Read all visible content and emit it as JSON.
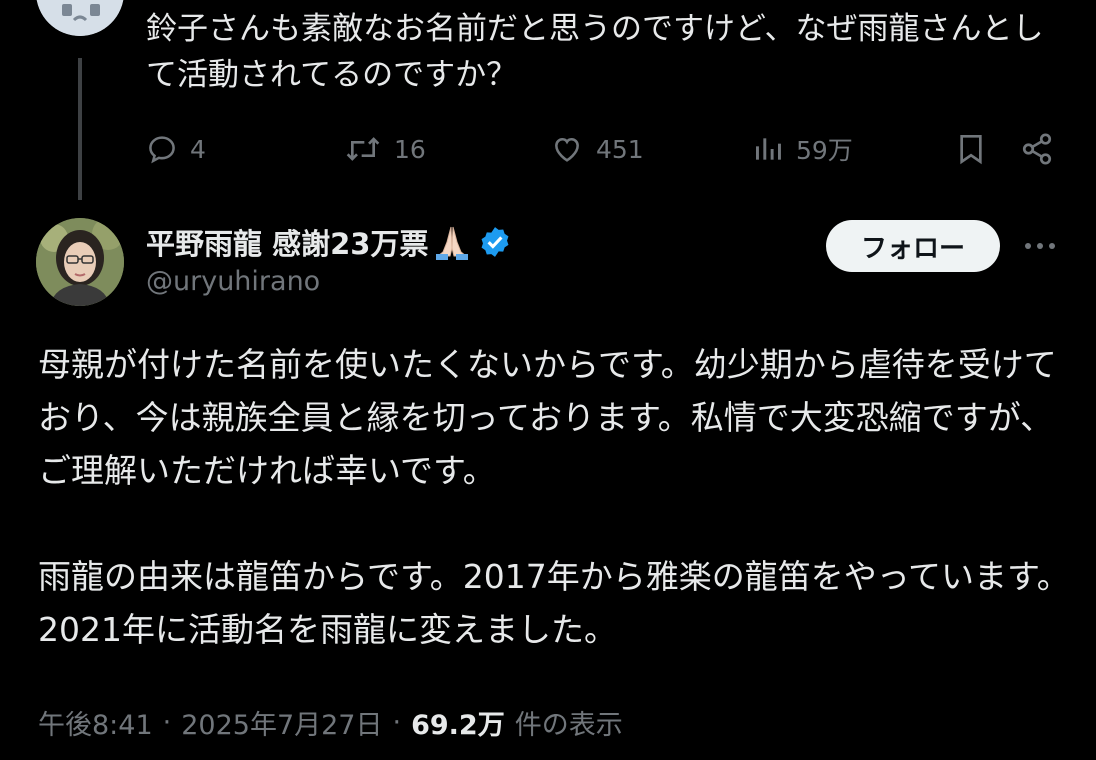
{
  "reply": {
    "text": "鈴子さんも素敵なお名前だと思うのですけど、なぜ雨龍さんとして活動されてるのですか？",
    "actions": {
      "reply_count": "4",
      "repost_count": "16",
      "like_count": "451",
      "view_count": "59万"
    }
  },
  "author": {
    "name": "平野雨龍 感謝23万票",
    "handle": "@uryuhirano",
    "follow_label": "フォロー"
  },
  "post": {
    "paragraphs": [
      "母親が付けた名前を使いたくないからです。幼少期から虐待を受けており、今は親族全員と縁を切っております。私情で大変恐縮ですが、ご理解いただければ幸いです。",
      "雨龍の由来は龍笛からです。2017年から雅楽の龍笛をやっています。2021年に活動名を雨龍に変えました。"
    ],
    "time": "午後8:41",
    "date": "2025年7月27日",
    "separator": "·",
    "views_count": "69.2万",
    "views_label": "件の表示"
  },
  "colors": {
    "background": "#000000",
    "text": "#e7e9ea",
    "muted": "#71767b",
    "verified": "#1d9bf0",
    "follow_bg": "#eff3f4"
  },
  "icons": [
    "reply-icon",
    "repost-icon",
    "like-icon",
    "views-icon",
    "bookmark-icon",
    "share-icon",
    "verified-badge-icon",
    "praying-hands-emoji",
    "more-options-icon"
  ]
}
